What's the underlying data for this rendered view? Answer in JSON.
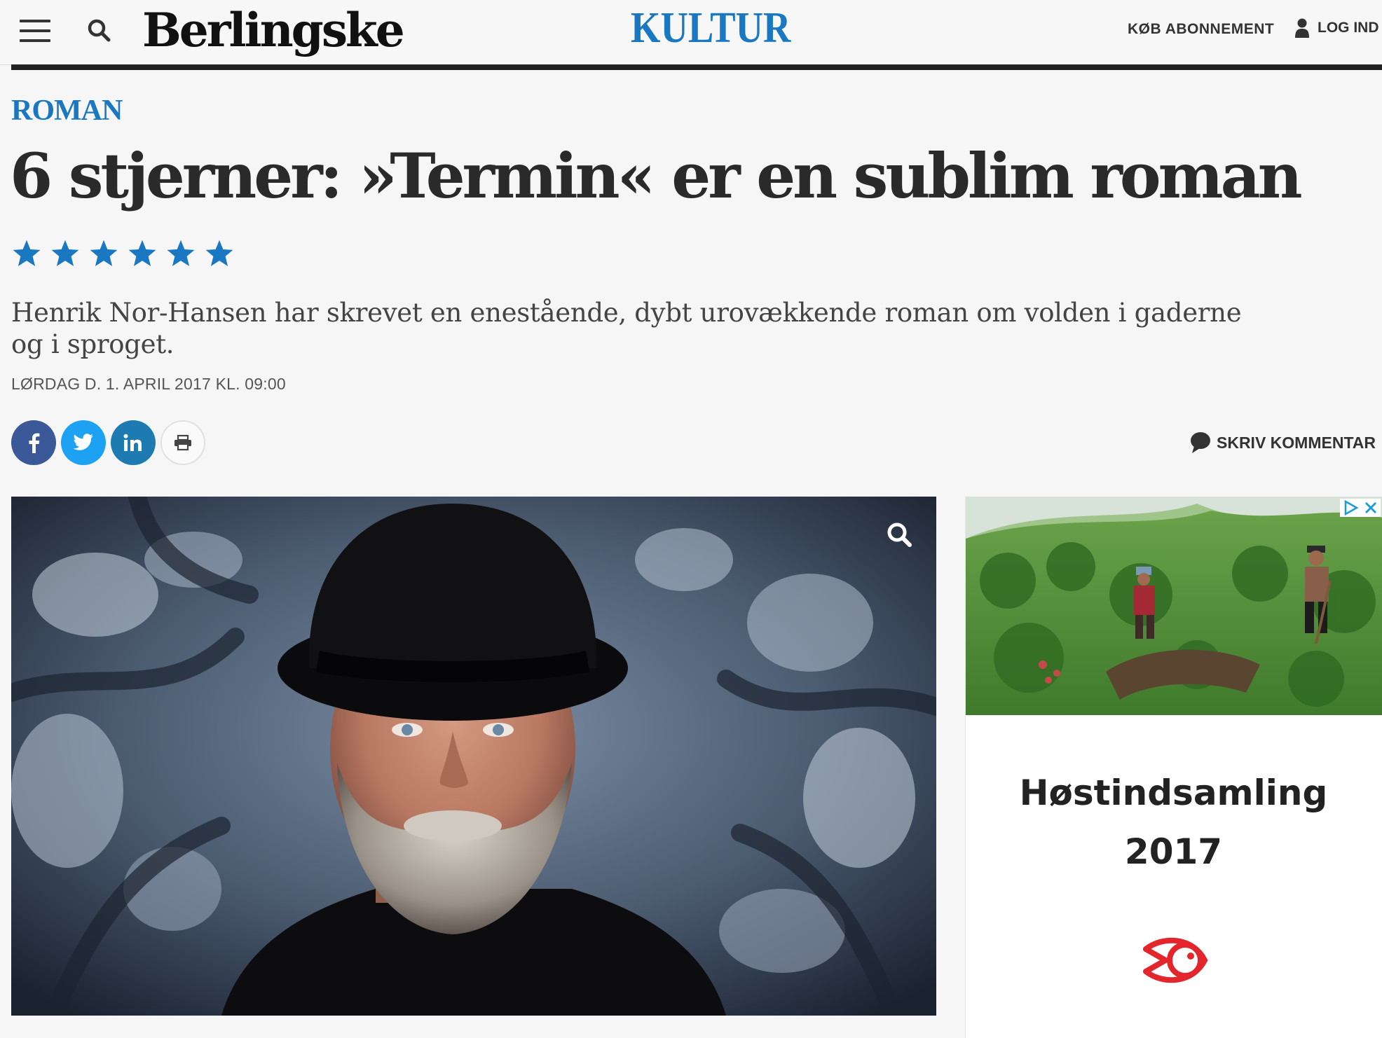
{
  "header": {
    "logo": "Berlingske",
    "section": "KULTUR",
    "subscribe_label": "KØB ABONNEMENT",
    "login_label": "LOG IND",
    "menu_icon": "hamburger-menu-icon",
    "search_icon": "search-icon",
    "user_icon": "user-icon"
  },
  "article": {
    "kicker": "ROMAN",
    "headline": "6 stjerner: »Termin« er en sublim roman",
    "rating": 6,
    "rating_max": 6,
    "deck": "Henrik Nor-Hansen har skrevet en enestående, dybt urovækkende roman om volden i gaderne og i sproget.",
    "dateline": "LØRDAG D. 1. APRIL 2017 KL. 09:00"
  },
  "share": {
    "buttons": [
      "facebook-icon",
      "twitter-icon",
      "linkedin-icon",
      "print-icon"
    ],
    "comment_label": "SKRIV KOMMENTAR",
    "comment_icon": "speech-bubble-icon"
  },
  "ad": {
    "title_line1": "Høstindsamling",
    "title_line2": "2017"
  },
  "colors": {
    "accent": "#1a78c2",
    "facebook": "#3b5998",
    "twitter": "#1da1f2",
    "linkedin": "#1d7bb1",
    "ad_logo": "#e3262b"
  }
}
